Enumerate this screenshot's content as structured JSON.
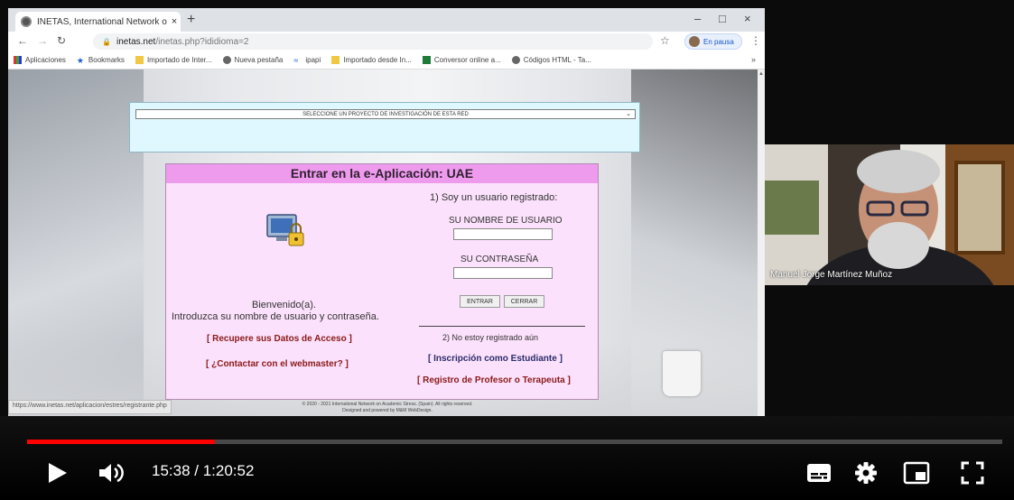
{
  "browser": {
    "tab_title": "INETAS, International Network o",
    "tab_close": "×",
    "new_tab": "+",
    "window_minimize": "–",
    "window_restore": "□",
    "window_close": "×",
    "url_host": "inetas.net",
    "url_path": "/inetas.php?ididioma=2",
    "profile_pill": "En pausa",
    "bookmarks": [
      "Aplicaciones",
      "Bookmarks",
      "Importado de Inter...",
      "Nueva pestaña",
      "ipapi",
      "Importado desde In...",
      "Conversor online a...",
      "Códigos HTML - Ta..."
    ],
    "bookmarks_more": "»",
    "status_url": "https://www.inetas.net/aplicacion/estres/registrante.php"
  },
  "page": {
    "project_select": "SELECCIONE UN PROYECTO DE INVESTIGACIÓN DE ESTA RED",
    "login_title": "Entrar en la e-Aplicación: UAE",
    "welcome": "Bienvenido(a).",
    "instructions": "Introduzca su nombre de usuario y contraseña.",
    "recover_link": "[ Recupere sus Datos de Acceso ]",
    "contact_link": "[ ¿Contactar con el webmaster? ]",
    "registered_heading": "1) Soy un usuario registrado:",
    "username_label": "SU NOMBRE DE USUARIO",
    "password_label": "SU CONTRASEÑA",
    "enter_button": "ENTRAR",
    "close_button": "CERRAR",
    "not_registered": "2) No estoy registrado aún",
    "student_link": "[ Inscripción como Estudiante ]",
    "teacher_link": "[ Registro de Profesor o Terapeuta ]",
    "footer_line1": "© 2020 - 2021 International Network on Academic Stress. (Spain). All rights reserved.",
    "footer_line2": "Designed and powered by M&M WebDesign."
  },
  "webcam": {
    "participant_name": "Manuel Jorge Martínez Muñoz"
  },
  "player": {
    "current_time": "15:38",
    "duration": "1:20:52",
    "time_display": "15:38 / 1:20:52",
    "progress_fraction": 0.193,
    "progress_color": "#ff0000"
  }
}
